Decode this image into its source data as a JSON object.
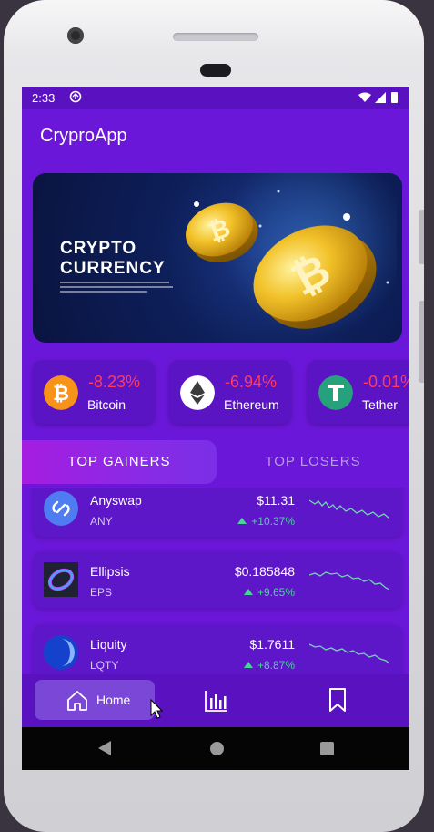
{
  "status_bar": {
    "time": "2:33",
    "icons": [
      "sync-icon",
      "wifi-icon",
      "signal-icon",
      "battery-icon"
    ]
  },
  "app": {
    "title": "CryproApp"
  },
  "banner": {
    "title_line1": "CRYPTO",
    "title_line2": "CURRENCY"
  },
  "coins": [
    {
      "name": "Bitcoin",
      "change": "-8.23%",
      "icon": "bitcoin-icon",
      "color": "#f7931a"
    },
    {
      "name": "Ethereum",
      "change": "-6.94%",
      "icon": "ethereum-icon",
      "color": "#ffffff"
    },
    {
      "name": "Tether",
      "change": "-0.01%",
      "icon": "tether-icon",
      "color": "#26a17b"
    }
  ],
  "tabs": {
    "gainers": "TOP GAINERS",
    "losers": "TOP LOSERS"
  },
  "list": [
    {
      "name": "Anyswap",
      "symbol": "ANY",
      "price": "$11.31",
      "change": "+10.37%",
      "icon": "anyswap-icon"
    },
    {
      "name": "Ellipsis",
      "symbol": "EPS",
      "price": "$0.185848",
      "change": "+9.65%",
      "icon": "ellipsis-icon"
    },
    {
      "name": "Liquity",
      "symbol": "LQTY",
      "price": "$1.7611",
      "change": "+8.87%",
      "icon": "liquity-icon"
    }
  ],
  "nav": {
    "home_label": "Home"
  },
  "colors": {
    "background": "#6b17d9",
    "negative": "#ff3b5c",
    "positive": "#48d597",
    "active_tab": "#a51de0"
  }
}
